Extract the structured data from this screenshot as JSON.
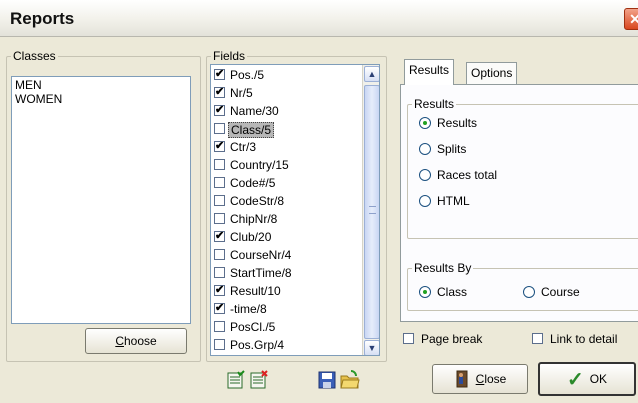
{
  "window": {
    "title": "Reports"
  },
  "classes": {
    "legend": "Classes",
    "items": [
      "MEN",
      "WOMEN"
    ],
    "choose_label": "Choose",
    "choose_underline": "C",
    "choose_rest": "hoose"
  },
  "fields": {
    "legend": "Fields",
    "items": [
      {
        "label": "Pos./5",
        "checked": true
      },
      {
        "label": "Nr/5",
        "checked": true
      },
      {
        "label": "Name/30",
        "checked": true
      },
      {
        "label": "Class/5",
        "checked": false,
        "selected": true
      },
      {
        "label": "Ctr/3",
        "checked": true
      },
      {
        "label": "Country/15",
        "checked": false
      },
      {
        "label": "Code#/5",
        "checked": false
      },
      {
        "label": "CodeStr/8",
        "checked": false
      },
      {
        "label": "ChipNr/8",
        "checked": false
      },
      {
        "label": "Club/20",
        "checked": true
      },
      {
        "label": "CourseNr/4",
        "checked": false
      },
      {
        "label": "StartTime/8",
        "checked": false
      },
      {
        "label": "Result/10",
        "checked": true
      },
      {
        "label": "-time/8",
        "checked": true
      },
      {
        "label": "PosCl./5",
        "checked": false
      },
      {
        "label": "Pos.Grp/4",
        "checked": false
      }
    ]
  },
  "tabs": [
    "Results",
    "Options"
  ],
  "results_group": {
    "legend": "Results",
    "options": [
      "Results",
      "Splits",
      "Races total",
      "HTML"
    ],
    "selected": "Results"
  },
  "results_by": {
    "legend": "Results By",
    "options": [
      "Class",
      "Course"
    ],
    "selected": "Class"
  },
  "checkboxes": {
    "page_break": "Page break",
    "link_to_detail": "Link to detail"
  },
  "buttons": {
    "close_underline": "C",
    "close_rest": "lose",
    "ok_label": "OK"
  },
  "icons": {
    "select_all": "check-all-icon",
    "deselect_all": "uncheck-all-icon",
    "save": "save-icon",
    "open": "open-folder-icon"
  }
}
